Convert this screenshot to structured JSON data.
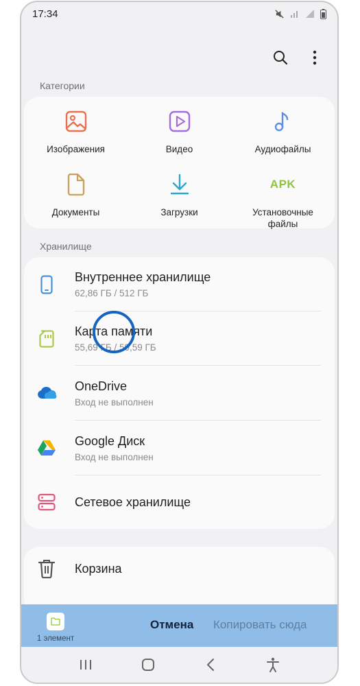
{
  "status_bar": {
    "time": "17:34"
  },
  "sections": {
    "categories_label": "Категории",
    "storage_label": "Хранилище"
  },
  "categories": [
    {
      "label": "Изображения",
      "icon": "image-icon"
    },
    {
      "label": "Видео",
      "icon": "video-icon"
    },
    {
      "label": "Аудиофайлы",
      "icon": "audio-icon"
    },
    {
      "label": "Документы",
      "icon": "document-icon"
    },
    {
      "label": "Загрузки",
      "icon": "download-icon"
    },
    {
      "label": "Установочные файлы",
      "icon": "apk-icon",
      "icon_text": "APK"
    }
  ],
  "storage": [
    {
      "title": "Внутреннее хранилище",
      "sub": "62,86 ГБ / 512 ГБ",
      "icon": "phone-icon"
    },
    {
      "title": "Карта памяти",
      "sub": "55,69 ГБ / 59,59 ГБ",
      "icon": "sd-card-icon"
    },
    {
      "title": "OneDrive",
      "sub": "Вход не выполнен",
      "icon": "onedrive-icon"
    },
    {
      "title": "Google Диск",
      "sub": "Вход не выполнен",
      "icon": "google-drive-icon"
    },
    {
      "title": "Сетевое хранилище",
      "icon": "network-storage-icon"
    }
  ],
  "trash": {
    "title": "Корзина",
    "icon": "trash-icon"
  },
  "bottom_sheet": {
    "selected_count": "1 элемент",
    "cancel_label": "Отмена",
    "copy_label": "Копировать сюда"
  },
  "colors": {
    "images": "#e8714f",
    "video": "#a46ce0",
    "audio": "#5b8fe6",
    "documents": "#c9a15e",
    "downloads": "#2aa7c9",
    "apk": "#8cc63f",
    "phone": "#4a90d9",
    "sd_card": "#a9c94a",
    "network": "#e0567a",
    "bottom_sheet": "#8fbde8",
    "tap_indicator": "#1565c0"
  }
}
